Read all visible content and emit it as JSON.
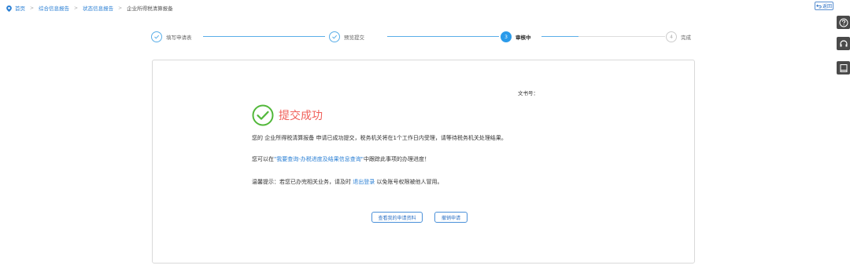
{
  "breadcrumb": {
    "home": "首页",
    "comprehensive": "综合信息报告",
    "status": "状态信息报告",
    "current": "企业所得税清算报备"
  },
  "back_label": "返回",
  "steps": [
    {
      "label": "填写申请表",
      "state": "done"
    },
    {
      "label": "预览提交",
      "state": "done"
    },
    {
      "label": "审核中",
      "state": "active",
      "num": "3"
    },
    {
      "label": "完成",
      "state": "pending",
      "num": "4"
    }
  ],
  "result": {
    "doc_no_label": "文书号：",
    "title": "提交成功",
    "msg1": "您的 企业所得税清算报备 申请已成功提交，税务机关将在1个工作日内受理，请等待税务机关处理结果。",
    "msg2_pre": "您可以在",
    "msg2_link": "\"我要查询-办税进度及结果信息查询\"",
    "msg2_post": "中跟踪此事项的办理进度！",
    "msg3_pre": "温馨提示：若您已办完相关业务，请及时 ",
    "msg3_link": "退出登录",
    "msg3_post": " 以免账号权限被他人冒用。"
  },
  "buttons": {
    "view": "查看我的申请资料",
    "cancel": "撤销申请"
  },
  "colors": {
    "accent": "#2b9bea",
    "success": "#52b83a",
    "title": "#f0605a"
  }
}
